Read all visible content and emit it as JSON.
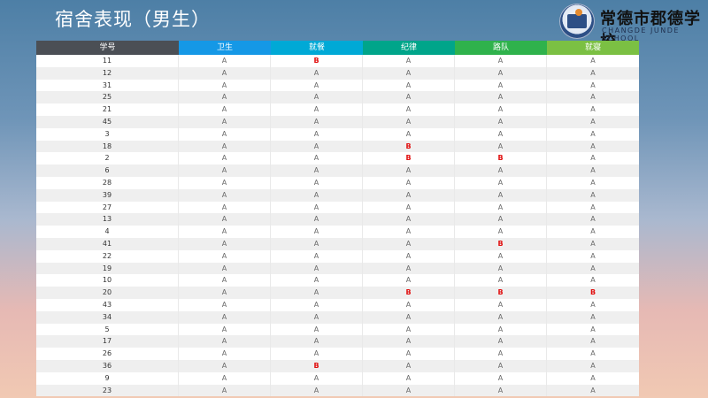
{
  "page": {
    "title": "宿舍表现（男生）"
  },
  "logo": {
    "school_name_cn": "常德市郡德学校",
    "school_name_en": "CHANGDE JUNDE SCHOOL"
  },
  "table": {
    "headers": [
      "学号",
      "卫生",
      "就餐",
      "纪律",
      "路队",
      "就寝"
    ],
    "header_colors": [
      "#4b4f55",
      "#1598e6",
      "#00a9d6",
      "#00a58a",
      "#2fb24c",
      "#7bc043"
    ],
    "rows": [
      [
        "11",
        "A",
        "B",
        "A",
        "A",
        "A"
      ],
      [
        "12",
        "A",
        "A",
        "A",
        "A",
        "A"
      ],
      [
        "31",
        "A",
        "A",
        "A",
        "A",
        "A"
      ],
      [
        "25",
        "A",
        "A",
        "A",
        "A",
        "A"
      ],
      [
        "21",
        "A",
        "A",
        "A",
        "A",
        "A"
      ],
      [
        "45",
        "A",
        "A",
        "A",
        "A",
        "A"
      ],
      [
        "3",
        "A",
        "A",
        "A",
        "A",
        "A"
      ],
      [
        "18",
        "A",
        "A",
        "B",
        "A",
        "A"
      ],
      [
        "2",
        "A",
        "A",
        "B",
        "B",
        "A"
      ],
      [
        "6",
        "A",
        "A",
        "A",
        "A",
        "A"
      ],
      [
        "28",
        "A",
        "A",
        "A",
        "A",
        "A"
      ],
      [
        "39",
        "A",
        "A",
        "A",
        "A",
        "A"
      ],
      [
        "27",
        "A",
        "A",
        "A",
        "A",
        "A"
      ],
      [
        "13",
        "A",
        "A",
        "A",
        "A",
        "A"
      ],
      [
        "4",
        "A",
        "A",
        "A",
        "A",
        "A"
      ],
      [
        "41",
        "A",
        "A",
        "A",
        "B",
        "A"
      ],
      [
        "22",
        "A",
        "A",
        "A",
        "A",
        "A"
      ],
      [
        "19",
        "A",
        "A",
        "A",
        "A",
        "A"
      ],
      [
        "10",
        "A",
        "A",
        "A",
        "A",
        "A"
      ],
      [
        "20",
        "A",
        "A",
        "B",
        "B",
        "B"
      ],
      [
        "43",
        "A",
        "A",
        "A",
        "A",
        "A"
      ],
      [
        "34",
        "A",
        "A",
        "A",
        "A",
        "A"
      ],
      [
        "5",
        "A",
        "A",
        "A",
        "A",
        "A"
      ],
      [
        "17",
        "A",
        "A",
        "A",
        "A",
        "A"
      ],
      [
        "26",
        "A",
        "A",
        "A",
        "A",
        "A"
      ],
      [
        "36",
        "A",
        "B",
        "A",
        "A",
        "A"
      ],
      [
        "9",
        "A",
        "A",
        "A",
        "A",
        "A"
      ],
      [
        "23",
        "A",
        "A",
        "A",
        "A",
        "A"
      ]
    ]
  }
}
